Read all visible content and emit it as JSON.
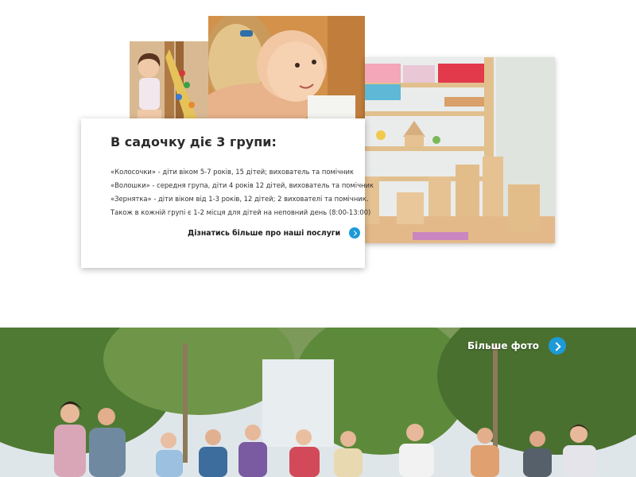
{
  "groups_section": {
    "title": "В садочку діє 3 групи:",
    "lines": [
      "«Колосочки» - діти віком 5-7 років, 15 дітей; вихователь та помічник",
      "«Волошки» - середня група, діти 4 років 12 дітей, вихователь та помічник",
      "«Зернятка» - діти віком від 1-3 років, 12 дітей; 2 вихователі та помічник.",
      "Також в кожній групі є 1-2 місця для дітей на неповний день (8:00-13:00)"
    ],
    "more_link": {
      "label": "Дізнатись більше про наші послуги",
      "icon": "chevron-right-icon"
    }
  },
  "gallery_section": {
    "more_photos_link": {
      "label": "Більше фото",
      "icon": "chevron-right-icon"
    }
  },
  "colors": {
    "accent": "#1d9ad8",
    "card_background": "#ffffff",
    "text": "#2b2b2b"
  }
}
